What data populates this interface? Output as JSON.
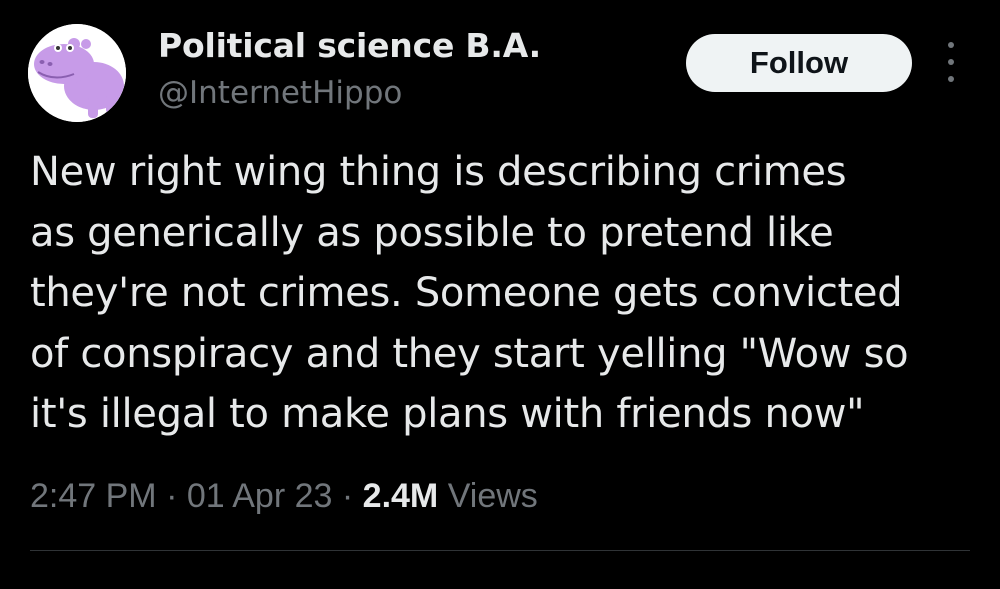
{
  "author": {
    "display_name": "Political science B.A.",
    "handle": "@InternetHippo",
    "avatar_icon": "purple-hippo-avatar"
  },
  "actions": {
    "follow_label": "Follow",
    "more_icon": "more-vertical-icon"
  },
  "tweet": {
    "lines": [
      "New right wing thing is describing crimes",
      "as generically as possible to pretend like",
      "they're not crimes. Someone gets convicted",
      "of conspiracy and they start yelling \"Wow so",
      "it's illegal to make plans with friends now\""
    ]
  },
  "meta": {
    "time": "2:47 PM",
    "separator": "·",
    "date": "01 Apr 23",
    "views_count": "2.4M",
    "views_label": "Views"
  },
  "colors": {
    "background": "#000000",
    "primary_text": "#e7e9ea",
    "secondary_text": "#71767b",
    "button_bg": "#eff3f4",
    "avatar_purple": "#c79be8",
    "divider": "#2f3336"
  }
}
